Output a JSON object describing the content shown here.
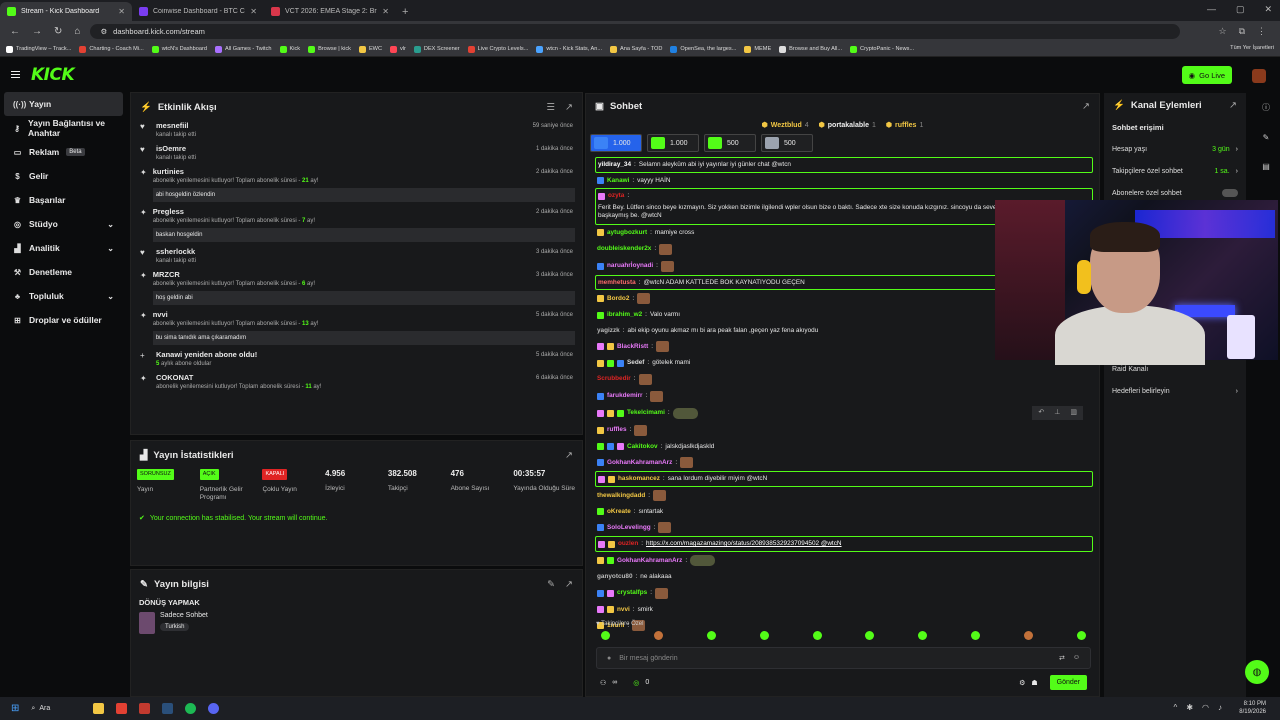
{
  "browser": {
    "tabs": [
      {
        "title": "Stream - Kick Dashboard",
        "color": "#53fc18",
        "active": true
      },
      {
        "title": "Coinwise Dashboard - BTC Cryp",
        "color": "#7a3df0",
        "active": false
      },
      {
        "title": "VCT 2026: EMEA Stage 2: Brack",
        "color": "#d9374b",
        "active": false
      }
    ],
    "url": "dashboard.kick.com/stream",
    "bookmarks": [
      "TradingView – Track...",
      "Charting - Coach Mi...",
      "wtcN's Dashboard",
      "All Games - Twitch",
      "Kick",
      "Browse | kick",
      "EWC",
      "vlr",
      "DEX Screener",
      "Live Crypto Levels...",
      "wtcn - Kick Stats, An...",
      "Ana Sayfa - TOD",
      "OpenSea, the larges...",
      "MEME",
      "Browse and Buy All...",
      "CryptoPanic - News..."
    ],
    "all_bookmarks": "Tüm Yer İşaretleri"
  },
  "topnav": {
    "logo": "KICK",
    "go_live": "Go Live"
  },
  "sidebar": {
    "items": [
      {
        "label": "Yayın",
        "icon": "broadcast-icon",
        "active": true
      },
      {
        "label": "Yayın Bağlantısı ve Anahtar",
        "icon": "key-icon"
      },
      {
        "label": "Reklam",
        "icon": "ad-icon",
        "badge": "Beta"
      },
      {
        "label": "Gelir",
        "icon": "dollar-icon"
      },
      {
        "label": "Başarılar",
        "icon": "trophy-icon"
      },
      {
        "label": "Stüdyo",
        "icon": "studio-icon",
        "chevron": true
      },
      {
        "label": "Analitik",
        "icon": "chart-icon",
        "chevron": true
      },
      {
        "label": "Denetleme",
        "icon": "hammer-icon"
      },
      {
        "label": "Topluluk",
        "icon": "community-icon",
        "chevron": true
      },
      {
        "label": "Droplar ve ödüller",
        "icon": "gift-icon"
      }
    ]
  },
  "activity": {
    "title": "Etkinlik Akışı",
    "events": [
      {
        "name": "mesnefiil",
        "sub": "kanalı takip etti",
        "time": "59 saniye önce",
        "icon": "♥"
      },
      {
        "name": "isOemre",
        "sub": "kanalı takip etti",
        "time": "1 dakika önce",
        "icon": "♥"
      },
      {
        "name": "kurtinies",
        "sub": "abonelik yenilemesini kutluyor! Toplam abonelik süresi -",
        "months": "21",
        "suffix": "ay!",
        "time": "2 dakika önce",
        "icon": "✦",
        "msg": "abi hosgeldin özlendin"
      },
      {
        "name": "Pregless",
        "sub": "abonelik yenilemesini kutluyor! Toplam abonelik süresi -",
        "months": "7",
        "suffix": "ay!",
        "time": "2 dakika önce",
        "icon": "✦",
        "msg": "baskan hosgeldin"
      },
      {
        "name": "ssherlockk",
        "sub": "kanalı takip etti",
        "time": "3 dakika önce",
        "icon": "♥"
      },
      {
        "name": "MRZCR",
        "sub": "abonelik yenilemesini kutluyor! Toplam abonelik süresi -",
        "months": "6",
        "suffix": "ay!",
        "time": "3 dakika önce",
        "icon": "✦",
        "msg": "hoş geldin abi"
      },
      {
        "name": "nvvi",
        "sub": "abonelik yenilemesini kutluyor! Toplam abonelik süresi -",
        "months": "13",
        "suffix": "ay!",
        "time": "5 dakika önce",
        "icon": "✦",
        "msg": "bu sima tanıdık ama çıkaramadım"
      },
      {
        "name": "Kanawi yeniden abone oldu!",
        "sub": "aylık abone oldular",
        "months": "5",
        "prefix": true,
        "time": "5 dakika önce",
        "icon": "+"
      },
      {
        "name": "COKONAT",
        "sub": "abonelik yenilemesini kutluyor! Toplam abonelik süresi -",
        "months": "11",
        "suffix": "ay!",
        "time": "6 dakika önce",
        "icon": "✦"
      }
    ]
  },
  "stats": {
    "title": "Yayın İstatistikleri",
    "items": [
      {
        "tag": "SORUNSUZ",
        "tag_color": "#53fc18",
        "label": "Yayın"
      },
      {
        "tag": "AÇIK",
        "tag_color": "#53fc18",
        "label": "Partnerlik Gelir Programı"
      },
      {
        "tag": "KAPALI",
        "tag_color": "#e02424",
        "label": "Çoklu Yayın"
      },
      {
        "value": "4.956",
        "label": "İzleyici"
      },
      {
        "value": "382.508",
        "label": "Takipçi"
      },
      {
        "value": "476",
        "label": "Abone Sayısı"
      },
      {
        "value": "00:35:57",
        "label": "Yayında Olduğu Süre"
      }
    ],
    "status": "Your connection has stabilised. Your stream will continue."
  },
  "info": {
    "title": "Yayın bilgisi",
    "stream_title": "DÖNÜŞ YAPMAK",
    "category": "Sadece Sohbet",
    "language": "Turkish"
  },
  "chat": {
    "title": "Sohbet",
    "pinned": [
      {
        "name": "Weztblud",
        "count": "4"
      },
      {
        "name": "portakalable",
        "count": "1"
      },
      {
        "name": "ruffles",
        "count": "1"
      }
    ],
    "gifts": [
      "1.000",
      "1.000",
      "500",
      "500"
    ],
    "messages": [
      {
        "user": "yildiray_34",
        "color": "#ffffff",
        "text": "Selamn aleyküm abi iyi yayınlar iyi günler chat @wtcn",
        "hl": true
      },
      {
        "user": "Kanawi",
        "color": "#53fc18",
        "text": "vayyy HAİN",
        "badges": 1
      },
      {
        "user": "ozyta",
        "color": "#e02424",
        "text": "Ferit Bey. Lütfen sinco beye kızmayın. Siz yokken bizimle ilgilendi wpler olsun bize o baktı. Sadece xte size konuda kızgınız. sincoyu da seveniz efendim ama sizin yeriniz başkaymış be. @wtcN",
        "hl": true,
        "badges": 1,
        "wrap": true
      },
      {
        "user": "aytugbozkurt",
        "color": "#53fc18",
        "text": "mamiye cross",
        "badges": 1
      },
      {
        "user": "doubleiskender2x",
        "color": "#53fc18",
        "text": "",
        "emote": true
      },
      {
        "user": "naruahrİoynadi",
        "color": "#e879f9",
        "text": "",
        "emote": true,
        "badges": 1
      },
      {
        "user": "memhetusta",
        "color": "#ff6b6b",
        "text": "@wtcN ADAM KATTLEDE BOK KAYNATIYODU GEÇEN",
        "hl": true
      },
      {
        "user": "Bordo2",
        "color": "#f2c744",
        "text": "",
        "emote": true,
        "badges": 1
      },
      {
        "user": "ibrahim_w2",
        "color": "#53fc18",
        "text": "Valo varmı",
        "badges": 1
      },
      {
        "user": "yagizzk",
        "color": "#bbbbbb",
        "text": "abi ekip oyunu akmaz mı bi ara peak falan ,geçen yaz fena akıyodu"
      },
      {
        "user": "BlackRistt",
        "color": "#e879f9",
        "text": "",
        "emote": true,
        "badges": 2
      },
      {
        "user": "Sedef",
        "color": "#dddddd",
        "text": "götelek mami",
        "badges": 3
      },
      {
        "user": "Scrubbedir",
        "color": "#e02424",
        "text": "",
        "emote": true
      },
      {
        "user": "farukdemirr",
        "color": "#e879f9",
        "text": "",
        "emote": true,
        "badges": 1
      },
      {
        "user": "Tekelcimami",
        "color": "#53fc18",
        "text": "",
        "emote2": true,
        "badges": 3,
        "tools": true
      },
      {
        "user": "ruffles",
        "color": "#e879f9",
        "text": "",
        "emote": true,
        "badges": 1
      },
      {
        "user": "Cakitokov",
        "color": "#53fc18",
        "text": "jalskdjaslkdjaskld",
        "badges": 3
      },
      {
        "user": "GokhanKahramanArz",
        "color": "#e879f9",
        "text": "",
        "emote": true,
        "badges": 1
      },
      {
        "user": "haskomancez",
        "color": "#f2c744",
        "text": "sana lordum diyebilir miyim @wtcN",
        "hl": true,
        "badges": 2
      },
      {
        "user": "thewalkingdadd",
        "color": "#f2c744",
        "text": "",
        "emote": true
      },
      {
        "user": "oKreate",
        "color": "#f2c744",
        "text": "sıntartak",
        "badges": 1
      },
      {
        "user": "SoloLevelingg",
        "color": "#e879f9",
        "text": "",
        "emote": true,
        "badges": 1
      },
      {
        "user": "ouzlen",
        "color": "#e02424",
        "text": "https://x.com/magazamazingo/status/2089385329237094502 @wtcN",
        "hl": true,
        "link": true,
        "badges": 2
      },
      {
        "user": "GokhanKahramanArz",
        "color": "#e879f9",
        "text": "",
        "emote2": true,
        "badges": 2
      },
      {
        "user": "ganyotcu80",
        "color": "#bbbbbb",
        "text": "ne alakaaa"
      },
      {
        "user": "crystalfps",
        "color": "#53fc18",
        "text": "",
        "emote": true,
        "badges": 2
      },
      {
        "user": "nvvi",
        "color": "#f2c744",
        "text": "smirk",
        "badges": 2
      },
      {
        "user": "1nurii",
        "color": "#f2c744",
        "text": "",
        "emote": true,
        "badges": 1
      }
    ],
    "followers_only": "Takipçilere Özel",
    "placeholder": "Bir mesaj gönderin",
    "viewers": "0",
    "send": "Gönder"
  },
  "channel": {
    "title": "Kanal Eylemleri",
    "section": "Sohbet erişimi",
    "items": [
      {
        "label": "Hesap yaşı",
        "value": "3 gün"
      },
      {
        "label": "Takipçilere özel sohbet",
        "value": "1 sa."
      },
      {
        "label": "Abonelere özel sohbet",
        "value": ""
      },
      {
        "label": "Raid Kanalı",
        "value": ""
      },
      {
        "label": "Hedefleri belirleyin",
        "value": ""
      }
    ]
  },
  "taskbar": {
    "search": "Ara",
    "time": "8:10 PM",
    "date": "8/19/2026"
  }
}
